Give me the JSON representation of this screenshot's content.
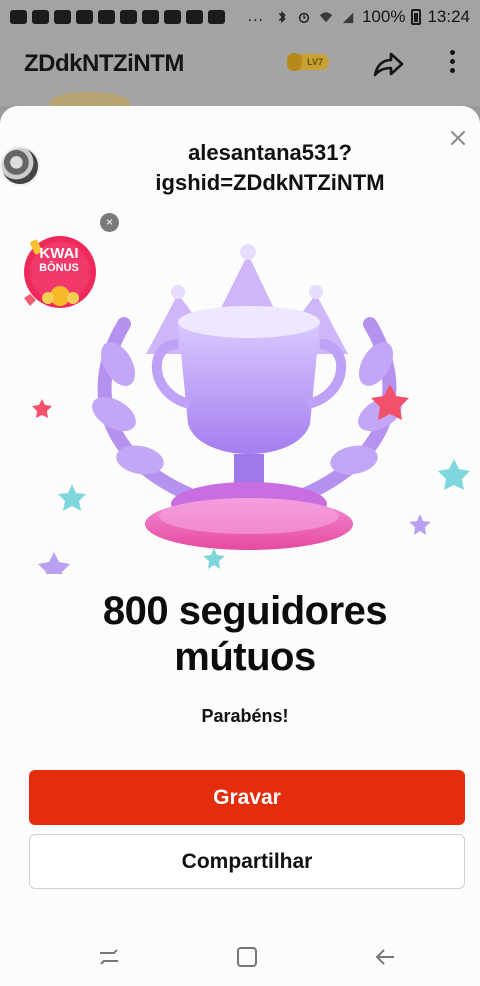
{
  "status_bar": {
    "dots": "...",
    "battery": "100%",
    "time": "13:24"
  },
  "app_header": {
    "title": "ZDdkNTZiNTM",
    "level_badge": "LV7"
  },
  "sheet": {
    "username_line1": "alesantana531?",
    "username_line2": "igshid=ZDdkNTZiNTM",
    "bonus": {
      "line1": "KWAI",
      "line2": "BÔNUS"
    },
    "title_line1": "800 seguidores",
    "title_line2": "mútuos",
    "subtitle": "Parabéns!",
    "primary_button": "Gravar",
    "secondary_button": "Compartilhar"
  },
  "icons": {
    "close": "close-icon",
    "share": "share-icon",
    "more": "more-vertical-icon",
    "nav_recents": "recents-icon",
    "nav_home": "home-icon",
    "nav_back": "back-icon"
  },
  "colors": {
    "primary": "#e32d0c",
    "trophy": "#b89af0"
  }
}
